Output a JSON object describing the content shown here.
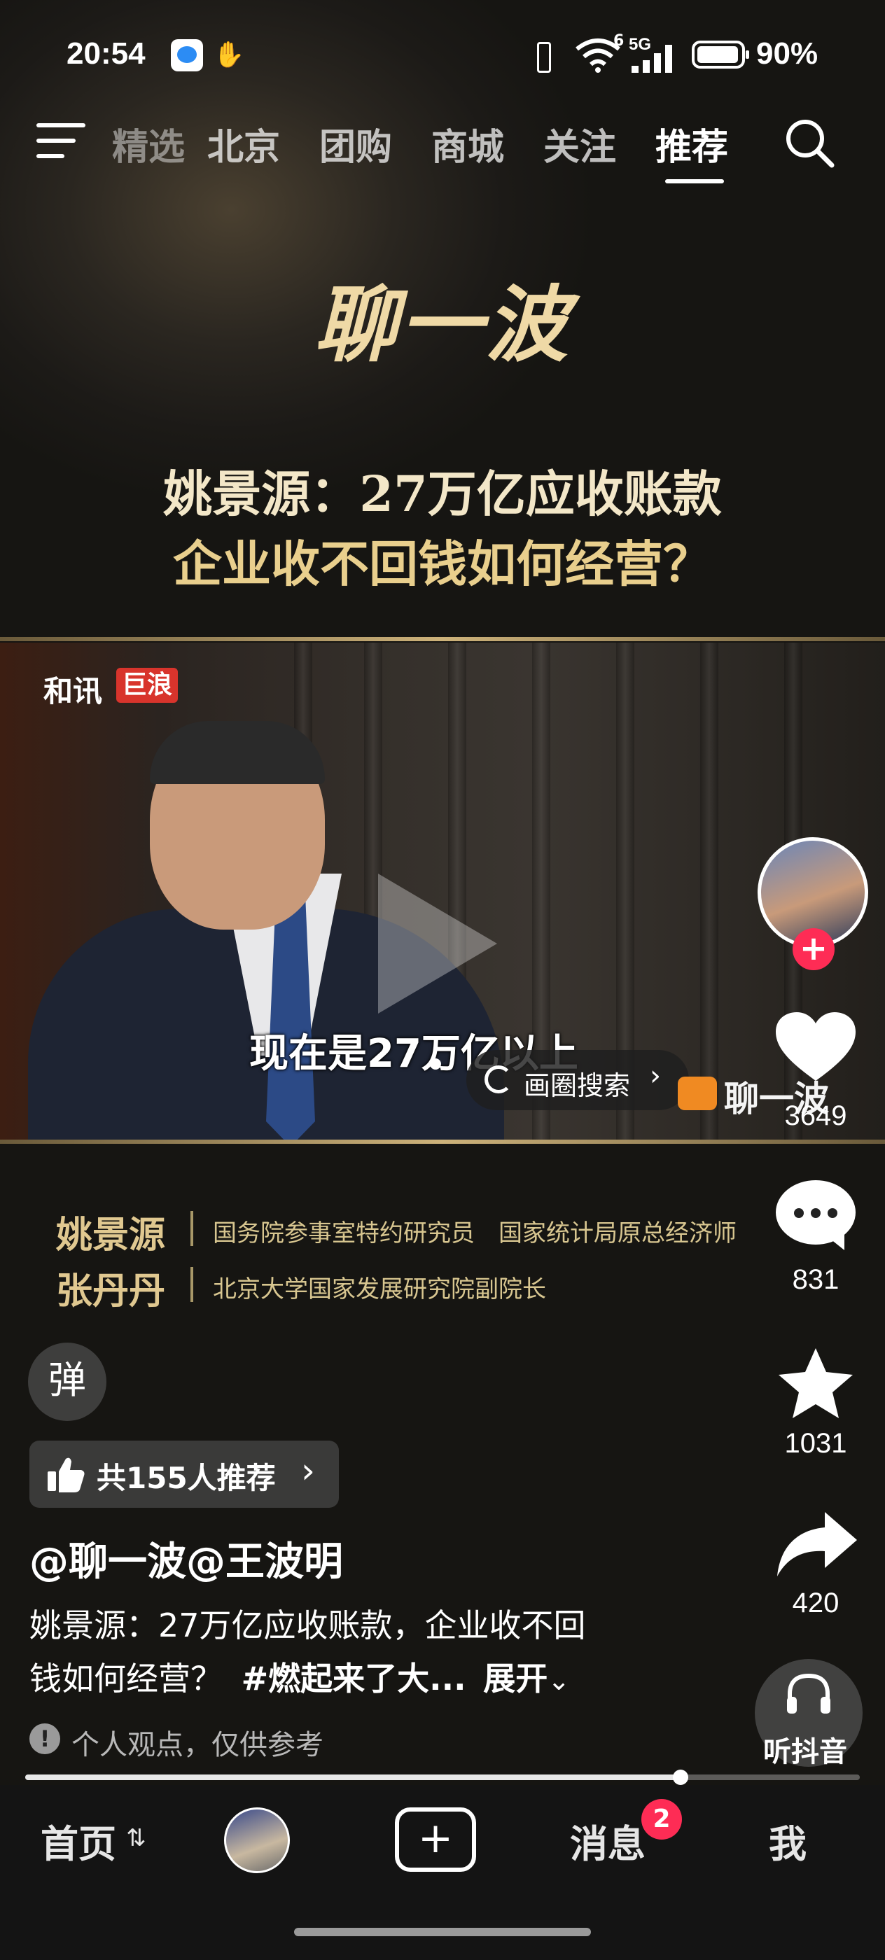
{
  "status_bar": {
    "time": "20:54",
    "network": "5G",
    "signal_prefix": "6",
    "battery": "90%"
  },
  "nav": {
    "tabs": [
      "精选",
      "北京",
      "团购",
      "商城",
      "关注",
      "推荐"
    ],
    "active_tab": "推荐"
  },
  "video": {
    "brand_title": "聊一波",
    "headline_line1": "姚景源：27万亿应收账款",
    "headline_line2": "企业收不回钱如何经营？",
    "source_logo_a": "和讯",
    "source_logo_b": "巨浪",
    "subtitle": "现在是27万亿以上",
    "watermark": "聊一波",
    "circle_search_label": "画圈搜索",
    "guests": [
      {
        "name": "姚景源",
        "title": "国务院参事室特约研究员　国家统计局原总经济师"
      },
      {
        "name": "张丹丹",
        "title": "北京大学国家发展研究院副院长"
      }
    ]
  },
  "actions": {
    "likes": "3649",
    "comments": "831",
    "favorites": "1031",
    "shares": "420",
    "listen_label": "听抖音"
  },
  "danmaku_label": "弹",
  "recommend": {
    "label": "共155人推荐"
  },
  "post": {
    "author": "@聊一波@王波明",
    "desc_line1": "姚景源：27万亿应收账款，企业收不回",
    "desc_line2_a": "钱如何经营？",
    "hashtag": "#燃起来了大...",
    "expand": "展开",
    "disclaimer": "个人观点，仅供参考"
  },
  "progress": {
    "fraction": 0.785
  },
  "bottom_nav": {
    "home": "首页",
    "messages": "消息",
    "messages_badge": "2",
    "me": "我"
  },
  "colors": {
    "accent_red": "#fe2c55",
    "gold": "#e8d3a0"
  }
}
